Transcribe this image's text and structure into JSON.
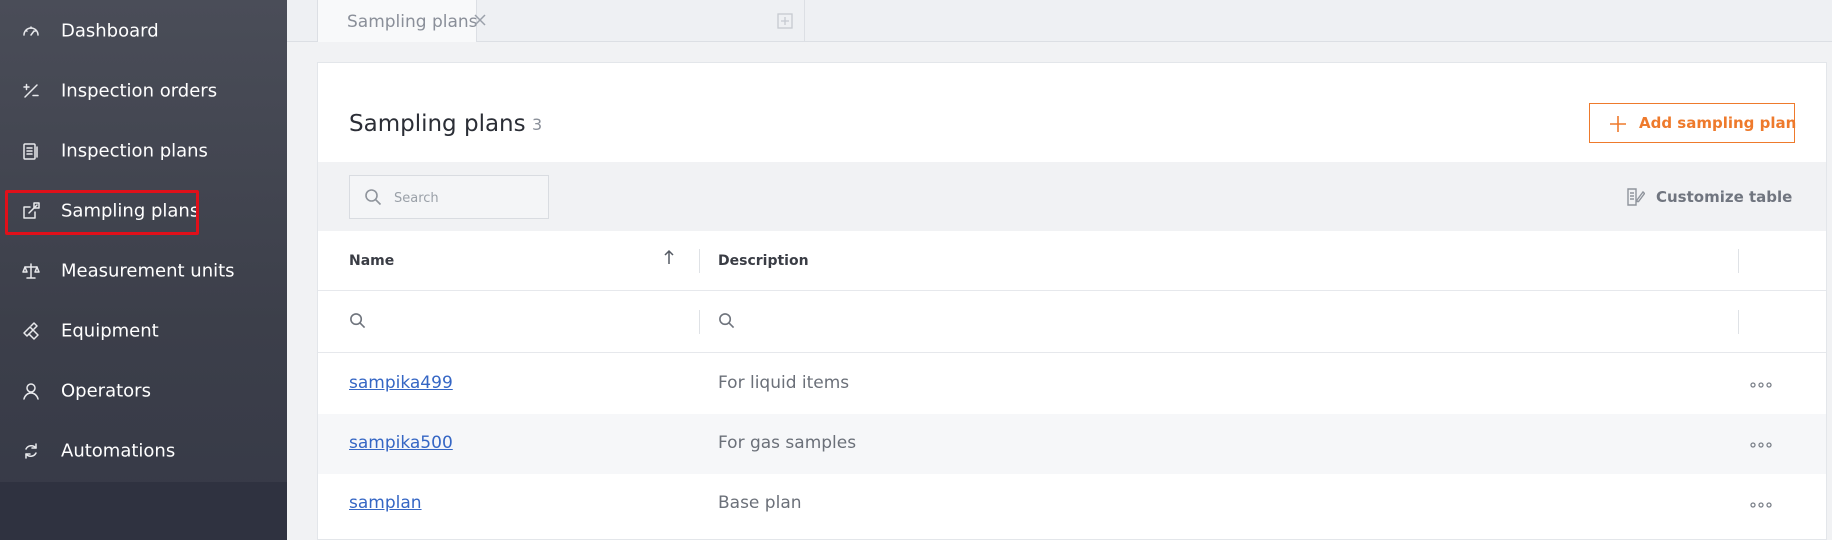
{
  "sidebar": {
    "items": [
      {
        "label": "Dashboard",
        "icon": "gauge-icon"
      },
      {
        "label": "Inspection orders",
        "icon": "percent-icon"
      },
      {
        "label": "Inspection plans",
        "icon": "clipboard-icon"
      },
      {
        "label": "Sampling plans",
        "icon": "share-box-icon"
      },
      {
        "label": "Measurement units",
        "icon": "scale-icon"
      },
      {
        "label": "Equipment",
        "icon": "tools-icon"
      },
      {
        "label": "Operators",
        "icon": "user-icon"
      },
      {
        "label": "Automations",
        "icon": "refresh-icon"
      }
    ]
  },
  "tabs": {
    "active_label": "Sampling plans"
  },
  "header": {
    "title": "Sampling plans",
    "count": "3",
    "add_button_label": "Add sampling plan"
  },
  "toolbar": {
    "search_placeholder": "Search",
    "customize_label": "Customize table"
  },
  "table": {
    "columns": [
      "Name",
      "Description"
    ],
    "rows": [
      {
        "name": "sampika499",
        "description": "For liquid items"
      },
      {
        "name": "sampika500",
        "description": "For gas samples"
      },
      {
        "name": "samplan",
        "description": "Base plan"
      }
    ]
  },
  "colors": {
    "accent": "#ee7a2c",
    "link": "#3566c4",
    "highlight": "#e0101a"
  }
}
